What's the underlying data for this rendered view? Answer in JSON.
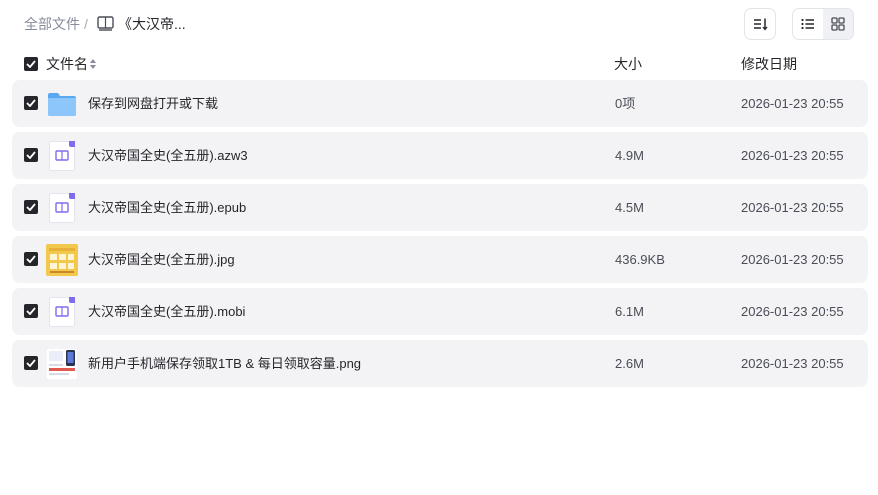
{
  "breadcrumb": {
    "root": "全部文件",
    "separator": "/",
    "current": "《大汉帝..."
  },
  "columns": {
    "name": "文件名",
    "size": "大小",
    "modified": "修改日期"
  },
  "files": [
    {
      "name": "保存到网盘打开或下载",
      "size": "0项",
      "modified": "2026-01-23 20:55",
      "icon": "folder-icon"
    },
    {
      "name": "大汉帝国全史(全五册).azw3",
      "size": "4.9M",
      "modified": "2026-01-23 20:55",
      "icon": "book-icon"
    },
    {
      "name": "大汉帝国全史(全五册).epub",
      "size": "4.5M",
      "modified": "2026-01-23 20:55",
      "icon": "book-icon"
    },
    {
      "name": "大汉帝国全史(全五册).jpg",
      "size": "436.9KB",
      "modified": "2026-01-23 20:55",
      "icon": "image-thumbnail"
    },
    {
      "name": "大汉帝国全史(全五册).mobi",
      "size": "6.1M",
      "modified": "2026-01-23 20:55",
      "icon": "book-icon"
    },
    {
      "name": "新用户手机端保存领取1TB & 每日领取容量.png",
      "size": "2.6M",
      "modified": "2026-01-23 20:55",
      "icon": "image-thumbnail"
    }
  ],
  "colors": {
    "row_bg": "#f3f3f5",
    "checkbox": "#25262b",
    "book_accent": "#7e6cf0",
    "folder": "#6cb4f5"
  }
}
